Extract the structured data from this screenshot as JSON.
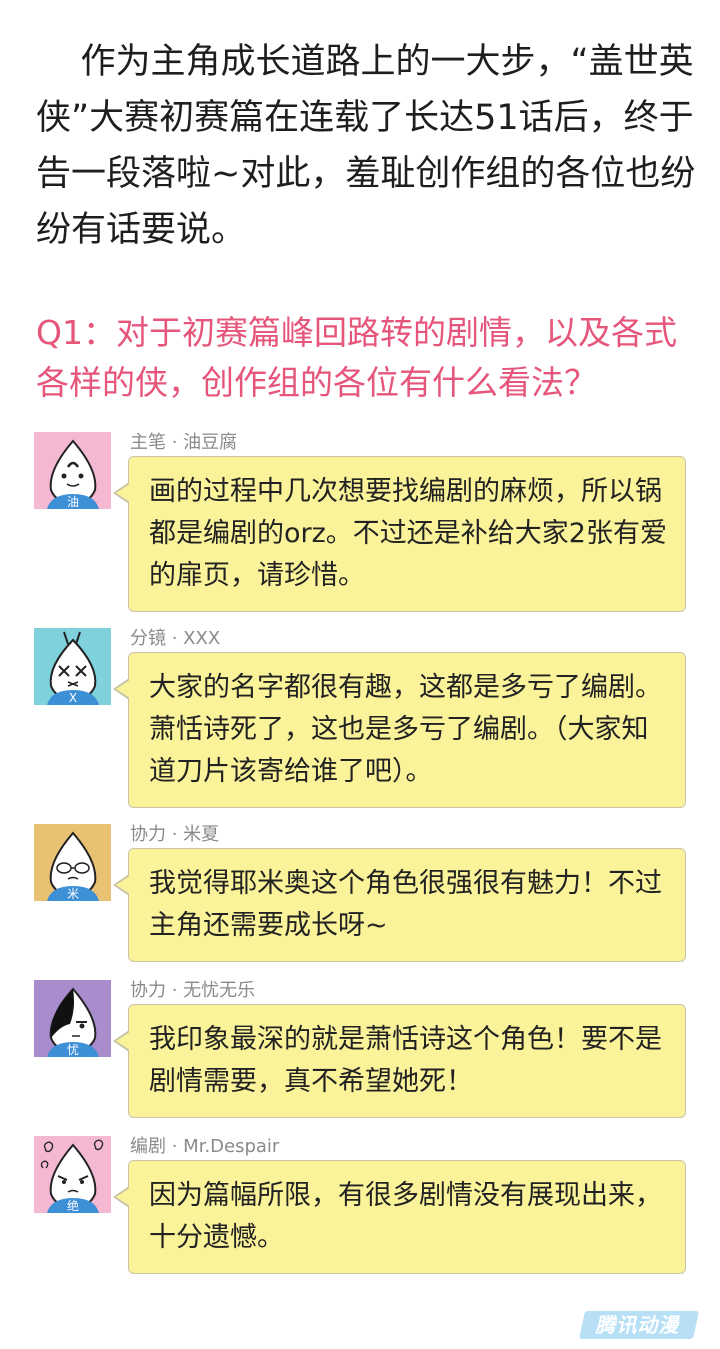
{
  "intro": {
    "text": "    作为主角成长道路上的一大步，“盖世英侠”大赛初赛篇在连载了长达51话后，终于告一段落啦~对此，羞耻创作组的各位也纷纷有话要说。"
  },
  "question": {
    "text": "Q1：对于初赛篇峰回路转的剧情，以及各式各样的侠，创作组的各位有什么看法？",
    "color": "#e6557a"
  },
  "comments": [
    {
      "author": "主笔 · 油豆腐",
      "avatar_bg": "#f5b8d2",
      "avatar_char": "油",
      "text": "画的过程中几次想要找编剧的麻烦，所以锅都是编剧的orz。不过还是补给大家2张有爱的扉页，请珍惜。"
    },
    {
      "author": "分镜 · XXX",
      "avatar_bg": "#7fd1dc",
      "avatar_char": "X",
      "text": "大家的名字都很有趣，这都是多亏了编剧。萧恬诗死了，这也是多亏了编剧。（大家知道刀片该寄给谁了吧）。"
    },
    {
      "author": "协力 · 米夏",
      "avatar_bg": "#e9c173",
      "avatar_char": "米",
      "text": "我觉得耶米奥这个角色很强很有魅力！不过主角还需要成长呀~"
    },
    {
      "author": "协力 · 无忧无乐",
      "avatar_bg": "#a98ccc",
      "avatar_char": "忧",
      "text": "我印象最深的就是萧恬诗这个角色！要不是剧情需要，真不希望她死！"
    },
    {
      "author": "编剧 · Mr.Despair",
      "avatar_bg": "#f5b8d2",
      "avatar_char": "绝",
      "text": "因为篇幅所限，有很多剧情没有展现出来，十分遗憾。"
    }
  ],
  "bubble_color": "#faf39a",
  "shirt_color": "#3d8fd6",
  "watermark": "腾讯动漫"
}
